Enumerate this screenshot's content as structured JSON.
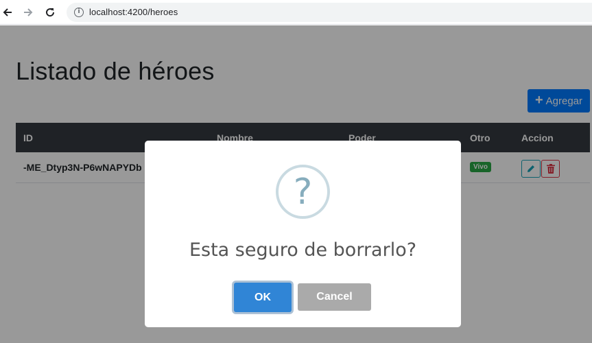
{
  "browser": {
    "url": "localhost:4200/heroes"
  },
  "page": {
    "title": "Listado de héroes",
    "add_button_label": "Agregar",
    "table": {
      "headers": [
        "ID",
        "Nombre",
        "Poder",
        "Otro",
        "Accion"
      ],
      "rows": [
        {
          "id": "-ME_Dtyp3N-P6wNAPYDb",
          "status": "Vivo"
        }
      ]
    }
  },
  "modal": {
    "icon": "question-mark-icon",
    "message": "Esta seguro de borrarlo?",
    "ok_label": "OK",
    "cancel_label": "Cancel"
  },
  "colors": {
    "primary": "#007bff",
    "table_header": "#343a40",
    "badge_success": "#28a745",
    "edit_outline": "#17a2b8",
    "delete_outline": "#dc3545",
    "confirm": "#3085d6",
    "cancel": "#aaaaaa"
  }
}
